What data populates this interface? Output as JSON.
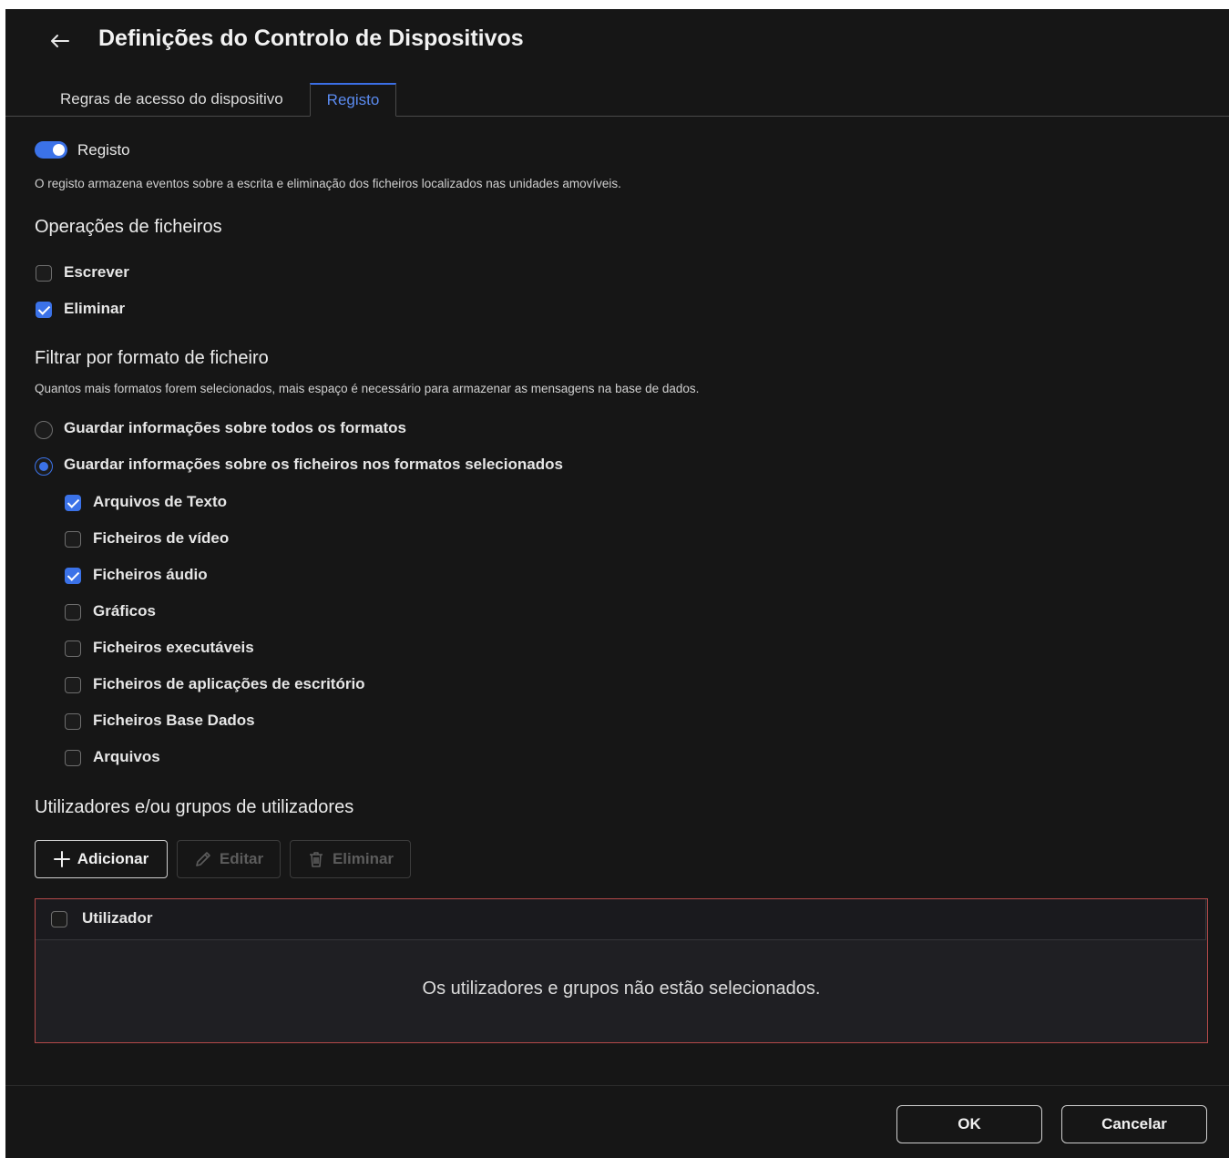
{
  "header": {
    "back_icon": "arrow-left-icon",
    "title": "Definições do Controlo de Dispositivos"
  },
  "tabs": [
    {
      "label": "Regras de acesso do dispositivo",
      "active": false
    },
    {
      "label": "Registo",
      "active": true
    }
  ],
  "logging": {
    "toggle_label": "Registo",
    "toggle_on": true,
    "description": "O registo armazena eventos sobre a escrita e eliminação dos ficheiros localizados nas unidades amovíveis."
  },
  "file_operations": {
    "title": "Operações de ficheiros",
    "items": [
      {
        "label": "Escrever",
        "checked": false
      },
      {
        "label": "Eliminar",
        "checked": true
      }
    ]
  },
  "format_filter": {
    "title": "Filtrar por formato de ficheiro",
    "description": "Quantos mais formatos forem selecionados, mais espaço é necessário para armazenar as mensagens na base de dados.",
    "options": [
      {
        "label": "Guardar informações sobre todos os formatos",
        "selected": false
      },
      {
        "label": "Guardar informações sobre os ficheiros nos formatos selecionados",
        "selected": true
      }
    ],
    "formats": [
      {
        "label": "Arquivos de Texto",
        "checked": true
      },
      {
        "label": "Ficheiros de vídeo",
        "checked": false
      },
      {
        "label": "Ficheiros áudio",
        "checked": true
      },
      {
        "label": "Gráficos",
        "checked": false
      },
      {
        "label": "Ficheiros executáveis",
        "checked": false
      },
      {
        "label": "Ficheiros de aplicações de escritório",
        "checked": false
      },
      {
        "label": "Ficheiros Base Dados",
        "checked": false
      },
      {
        "label": "Arquivos",
        "checked": false
      }
    ]
  },
  "users": {
    "title": "Utilizadores e/ou grupos de utilizadores",
    "buttons": {
      "add": "Adicionar",
      "edit": "Editar",
      "delete": "Eliminar"
    },
    "table": {
      "column_user": "Utilizador",
      "empty_message": "Os utilizadores e grupos não estão selecionados."
    }
  },
  "footer": {
    "ok": "OK",
    "cancel": "Cancelar"
  },
  "colors": {
    "accent": "#3b72e8",
    "background": "#161616",
    "table_border_error": "#b54a4a"
  }
}
